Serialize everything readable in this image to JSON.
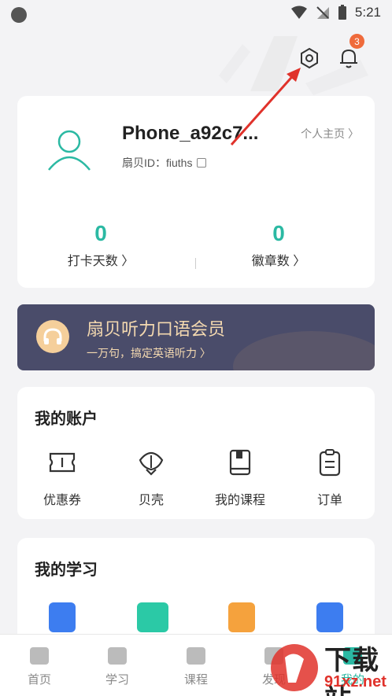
{
  "status_bar": {
    "time": "5:21"
  },
  "header": {
    "notification_count": "3"
  },
  "profile": {
    "username": "Phone_a92c7...",
    "user_id": "扇贝ID：fiuths",
    "homepage_link": "个人主页 〉",
    "stats": [
      {
        "value": "0",
        "label": "打卡天数 〉"
      },
      {
        "value": "0",
        "label": "徽章数 〉"
      }
    ]
  },
  "member_banner": {
    "title": "扇贝听力口语会员",
    "subtitle": "一万句，搞定英语听力 〉"
  },
  "account": {
    "title": "我的账户",
    "items": [
      {
        "label": "优惠券",
        "icon": "ticket-icon"
      },
      {
        "label": "贝壳",
        "icon": "shell-icon"
      },
      {
        "label": "我的课程",
        "icon": "book-icon"
      },
      {
        "label": "订单",
        "icon": "clipboard-icon"
      }
    ]
  },
  "study": {
    "title": "我的学习",
    "icons": [
      {
        "icon": "notes-icon",
        "color": "#3d7df0"
      },
      {
        "icon": "chart-icon",
        "color": "#2bc9a6"
      },
      {
        "icon": "word-card-icon",
        "color": "#f5a23d"
      },
      {
        "icon": "file-icon",
        "color": "#3d7df0"
      }
    ]
  },
  "tabbar": {
    "tabs": [
      {
        "label": "首页",
        "icon": "home-icon"
      },
      {
        "label": "学习",
        "icon": "play-icon"
      },
      {
        "label": "课程",
        "icon": "trend-icon"
      },
      {
        "label": "发现",
        "icon": "discover-icon"
      },
      {
        "label": "我的",
        "icon": "profile-icon"
      }
    ]
  },
  "watermark": {
    "line1": "下载站",
    "line2": "91xz.net"
  },
  "colors": {
    "accent": "#2bb9a3",
    "badge": "#ef6a3b",
    "banner_bg": "#4a4c6a",
    "banner_text": "#f4d9b0",
    "annotation_arrow": "#e0322b"
  }
}
